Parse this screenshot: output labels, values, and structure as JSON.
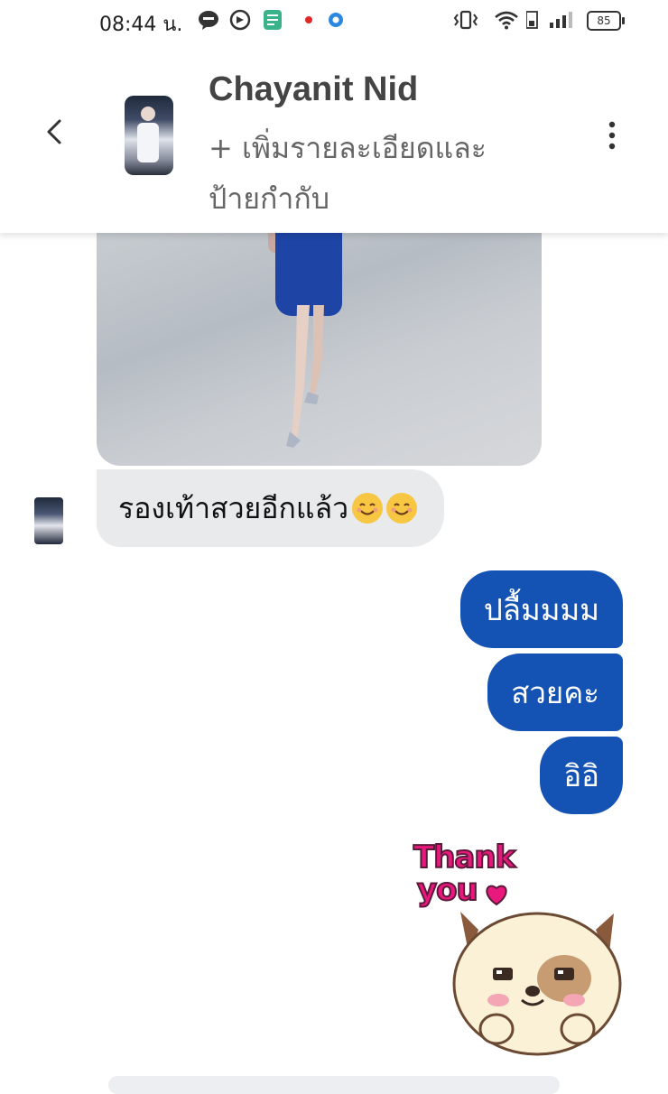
{
  "status_bar": {
    "time": "08:44 น.",
    "battery": "85",
    "icons": [
      "line-icon",
      "refresh-icon",
      "calculator-icon",
      "notification-dot-icon",
      "app-dot-icon",
      "vibrate-icon",
      "wifi-icon",
      "signal-icon"
    ]
  },
  "header": {
    "name": "Chayanit Nid",
    "subtitle_line1": "+ เพิ่มรายละเอียดและ",
    "subtitle_line2": "ป้ายกำกับ"
  },
  "messages": [
    {
      "side": "in",
      "text": "รองเท้าสวยอีกแล้ว",
      "emojis": [
        "smiling-face-emoji",
        "smiling-face-emoji"
      ]
    },
    {
      "side": "out",
      "text": "ปลื้มมมม"
    },
    {
      "side": "out",
      "text": "สวยคะ"
    },
    {
      "side": "out",
      "text": "อิอิ"
    }
  ],
  "sticker": {
    "line1": "Thank",
    "line2": "you"
  },
  "colors": {
    "outgoing_bubble": "#1453b4",
    "incoming_bubble": "#e9eaec",
    "sticker_text": "#e8187d"
  }
}
